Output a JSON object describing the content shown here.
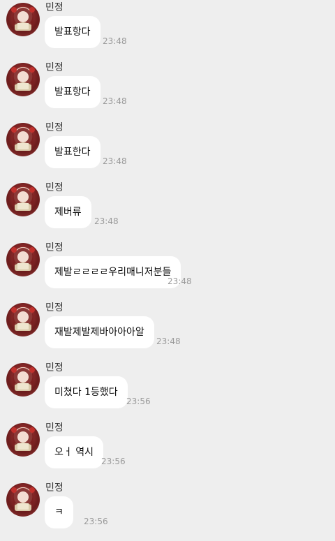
{
  "messages": [
    {
      "sender": "민정",
      "text": "발표항다",
      "time": "23:48"
    },
    {
      "sender": "민정",
      "text": "발표항다",
      "time": "23:48"
    },
    {
      "sender": "민정",
      "text": "발표한다",
      "time": "23:48"
    },
    {
      "sender": "민정",
      "text": "제버류",
      "time": "23:48"
    },
    {
      "sender": "민정",
      "text": "제발ㄹㄹㄹㄹ우리매니저분들",
      "time": "23:48"
    },
    {
      "sender": "민정",
      "text": "재발제발제바아아아알",
      "time": "23:48"
    },
    {
      "sender": "민정",
      "text": "미쳤다 1등했다",
      "time": "23:56"
    },
    {
      "sender": "민정",
      "text": "오ㅓ 역시",
      "time": "23:56"
    },
    {
      "sender": "민정",
      "text": "ㅋ",
      "time": "23:56"
    }
  ]
}
